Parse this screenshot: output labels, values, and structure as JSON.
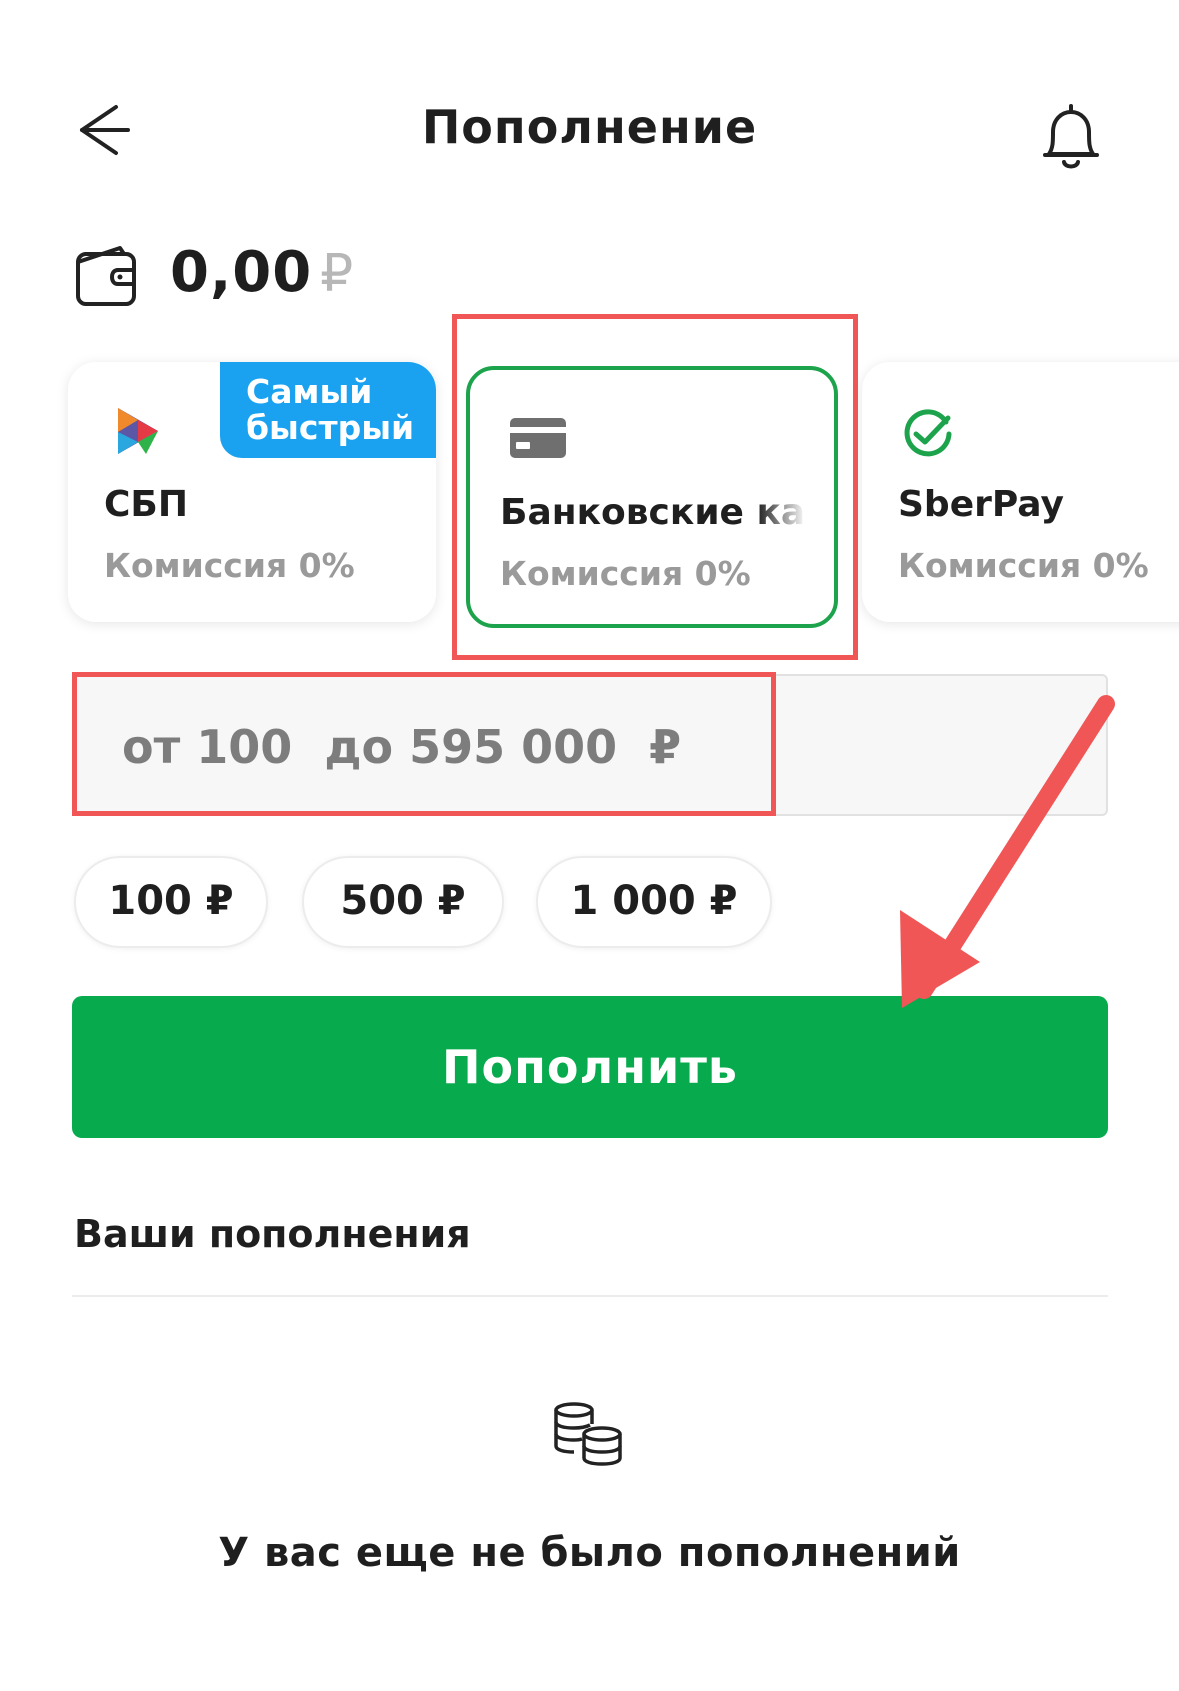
{
  "header": {
    "title": "Пополнение",
    "back_icon": "arrow-left-icon",
    "bell_icon": "bell-icon"
  },
  "balance": {
    "amount": "0,00",
    "currency": "₽",
    "icon": "wallet-icon"
  },
  "methods": [
    {
      "id": "sbp",
      "title": "СБП",
      "commission": "Комиссия 0%",
      "badge": "Самый быстрый",
      "icon": "sbp-logo-icon"
    },
    {
      "id": "bank-card",
      "title": "Банковские карты",
      "commission": "Комиссия 0%",
      "icon": "credit-card-icon",
      "selected": true
    },
    {
      "id": "sberpay",
      "title": "SberPay",
      "commission": "Комиссия 0%",
      "icon": "sberpay-check-icon"
    }
  ],
  "amount_input": {
    "placeholder": "от 100  до 595 000  ₽",
    "value": ""
  },
  "quick_amounts": [
    "100 ₽",
    "500 ₽",
    "1 000 ₽"
  ],
  "topup_button": "Пополнить",
  "history": {
    "title": "Ваши пополнения",
    "empty_text": "У вас еще не было пополнений",
    "empty_icon": "coins-stack-icon"
  },
  "colors": {
    "primary_green": "#07aa4d",
    "selected_border": "#1ca34b",
    "badge_blue": "#1aa2f0",
    "annotation_red": "#f05656"
  }
}
